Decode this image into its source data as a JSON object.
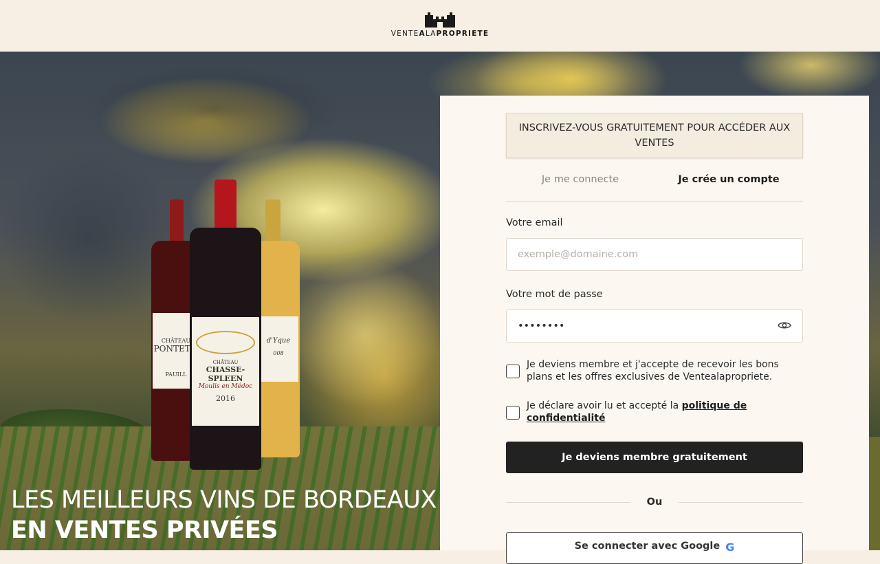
{
  "header": {
    "logo_alt": "Château icon",
    "logo_text_part1": "VENTE",
    "logo_text_part2": "A",
    "logo_text_part3": "LA",
    "logo_text_part4": "PROPRIETE"
  },
  "hero": {
    "title_line1": "LES MEILLEURS VINS DE BORDEAUX",
    "title_line2": "EN VENTES PRIVÉES",
    "bottles": [
      {
        "name": "Château Pontet-Canet",
        "label_line1": "CHÂTEAU",
        "label_line2": "PONTET-C",
        "label_line3": "PAUILL"
      },
      {
        "name": "Château Chasse-Spleen",
        "label_line1": "CHÂTEAU",
        "label_line2": "CHASSE-SPLEEN",
        "label_line3": "Moulis en Médoc",
        "vintage": "2016"
      },
      {
        "name": "Château d'Yquem",
        "label_line1": "d'Yque",
        "label_line2": "008"
      }
    ]
  },
  "form": {
    "banner": "INSCRIVEZ-VOUS GRATUITEMENT POUR ACCÉDER AUX VENTES",
    "tabs": [
      {
        "label": "Je me connecte",
        "active": false
      },
      {
        "label": "Je crée un compte",
        "active": true
      }
    ],
    "email_label": "Votre email",
    "email_placeholder": "exemple@domaine.com",
    "password_label": "Votre mot de passe",
    "password_value": "********",
    "checkbox1_text": "Je deviens membre et j'accepte de recevoir les bons plans et les offres exclusives de Ventealapropriete.",
    "checkbox2_text": "Je déclare avoir lu et accepté la",
    "checkbox2_link": "politique de confidentialité",
    "submit_label": "Je deviens membre gratuitement",
    "divider_text": "Ou",
    "google_label": "Se connecter avec Google",
    "google_icon": "G"
  },
  "colors": {
    "header_bg": "#f7efe3",
    "panel_bg": "#fcf8f1",
    "primary_button": "#222222",
    "google_blue": "#4285f4"
  }
}
